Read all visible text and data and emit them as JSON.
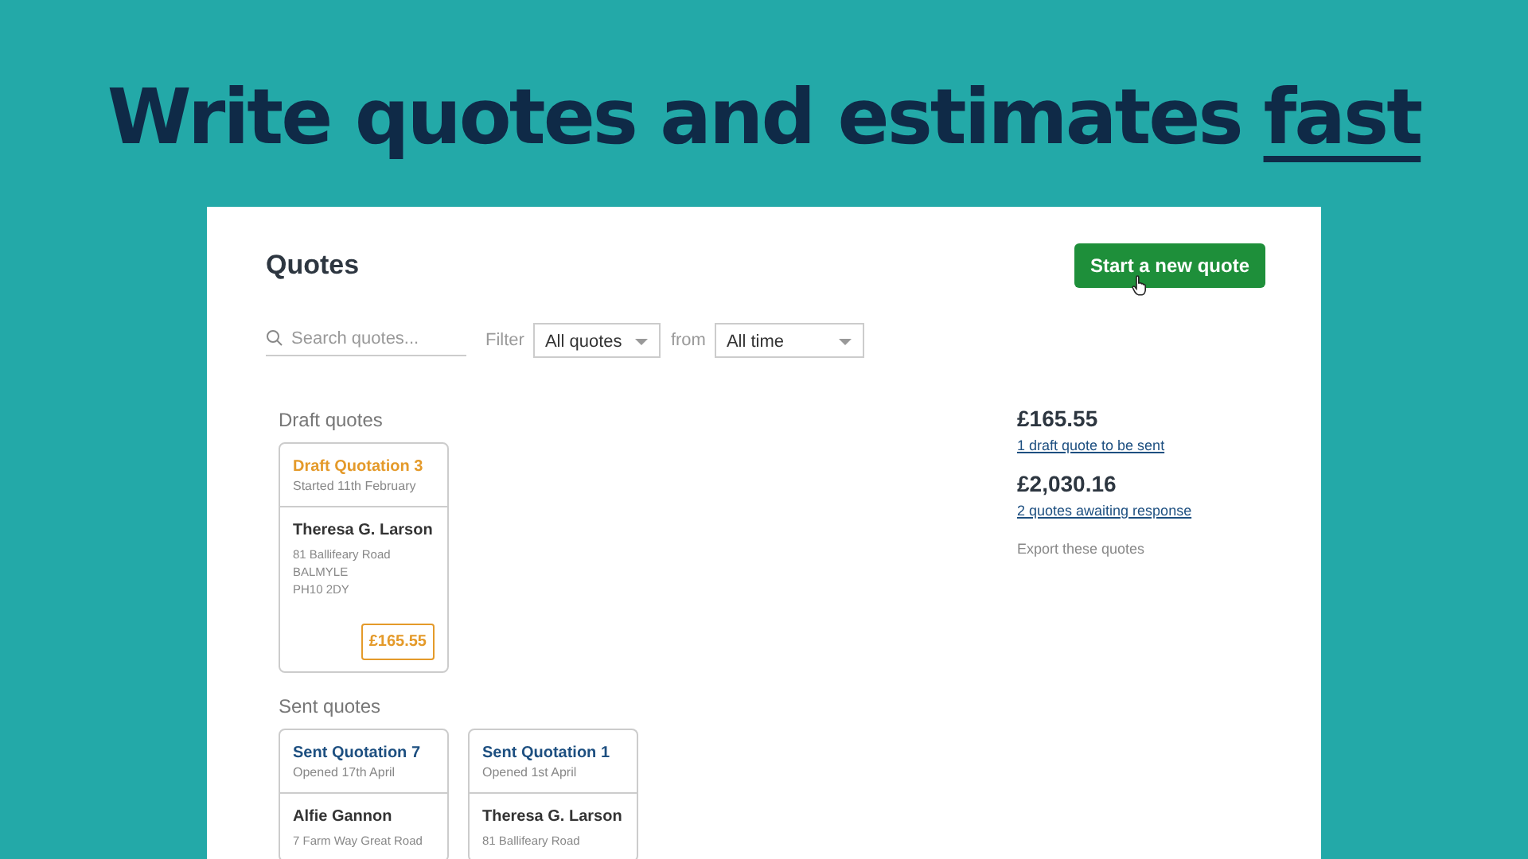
{
  "headline": {
    "text": "Write quotes and estimates",
    "emphasis": "fast"
  },
  "page": {
    "title": "Quotes",
    "new_button": "Start a new quote"
  },
  "filters": {
    "search_placeholder": "Search quotes...",
    "filter_label": "Filter",
    "filter_value": "All quotes",
    "from_label": "from",
    "from_value": "All time"
  },
  "sections": [
    {
      "title": "Draft quotes",
      "cards": [
        {
          "kind": "draft",
          "title": "Draft Quotation 3",
          "date": "Started 11th February",
          "customer": "Theresa G. Larson",
          "address": [
            "81 Ballifeary Road",
            "BALMYLE",
            "PH10 2DY"
          ],
          "amount": "£165.55"
        }
      ]
    },
    {
      "title": "Sent quotes",
      "cards": [
        {
          "kind": "sent",
          "title": "Sent Quotation 7",
          "date": "Opened 17th April",
          "customer": "Alfie Gannon",
          "address": [
            "7 Farm Way Great Road"
          ]
        },
        {
          "kind": "sent",
          "title": "Sent Quotation 1",
          "date": "Opened 1st April",
          "customer": "Theresa G. Larson",
          "address": [
            "81 Ballifeary Road"
          ]
        }
      ]
    }
  ],
  "summary": {
    "items": [
      {
        "amount": "£165.55",
        "link": "1 draft quote to be sent"
      },
      {
        "amount": "£2,030.16",
        "link": "2 quotes awaiting response"
      }
    ],
    "export": "Export these quotes"
  }
}
